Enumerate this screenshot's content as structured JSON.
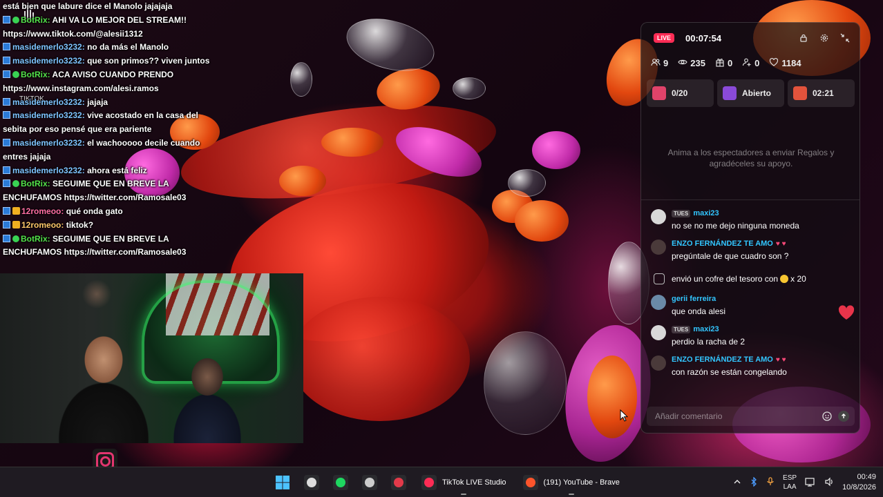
{
  "overlay_chat": [
    {
      "user": "",
      "user_style": "u-blue",
      "badges": [],
      "text": "está bien que labure dice el Manolo jajajaja"
    },
    {
      "user": "BotRix:",
      "user_style": "u-green",
      "badges": [
        "badge",
        "badge2"
      ],
      "text": " AHI VA LO MEJOR DEL STREAM!! https://www.tiktok.com/@alesii1312"
    },
    {
      "user": "masidemerlo3232:",
      "user_style": "u-blue",
      "badges": [
        "badge"
      ],
      "text": " no da más el Manolo"
    },
    {
      "user": "masidemerlo3232:",
      "user_style": "u-blue",
      "badges": [
        "badge"
      ],
      "text": " que son primos?? viven juntos"
    },
    {
      "user": "BotRix:",
      "user_style": "u-green",
      "badges": [
        "badge",
        "badge2"
      ],
      "text": " ACA AVISO CUANDO PRENDO https://www.instagram.com/alesi.ramos"
    },
    {
      "user": "masidemerlo3232:",
      "user_style": "u-blue",
      "badges": [
        "badge"
      ],
      "text": " jajaja"
    },
    {
      "user": "masidemerlo3232:",
      "user_style": "u-blue",
      "badges": [
        "badge"
      ],
      "text": " vive acostado en la casa del sebita por eso pensé que era pariente"
    },
    {
      "user": "masidemerlo3232:",
      "user_style": "u-blue",
      "badges": [
        "badge"
      ],
      "text": " el wachooooo decile cuando entres jajaja"
    },
    {
      "user": "masidemerlo3232:",
      "user_style": "u-blue",
      "badges": [
        "badge"
      ],
      "text": " ahora está feliz"
    },
    {
      "user": "BotRix:",
      "user_style": "u-green",
      "badges": [
        "badge",
        "badge2"
      ],
      "text": " SEGUIME QUE EN BREVE LA ENCHUFAMOS https://twitter.com/Ramosale03"
    },
    {
      "user": "12romeoo:",
      "user_style": "u-pink",
      "badges": [
        "badge",
        "badge3"
      ],
      "text": " qué onda gato"
    },
    {
      "user": "12romeoo:",
      "user_style": "u-yellow",
      "badges": [
        "badge",
        "badge3"
      ],
      "text": " tiktok?"
    },
    {
      "user": "BotRix:",
      "user_style": "u-green",
      "badges": [
        "badge",
        "badge2"
      ],
      "text": " SEGUIME QUE EN BREVE LA ENCHUFAMOS https://twitter.com/Ramosale03"
    }
  ],
  "overlay_mini_label": "TIKTOK",
  "live_panel": {
    "badge": "LIVE",
    "timer": "00:07:54",
    "header_icons": [
      "lock-icon",
      "gear-icon",
      "shrink-icon"
    ],
    "stats": {
      "viewers": "9",
      "views": "235",
      "gifts": "0",
      "new_followers": "0",
      "likes": "1184"
    },
    "goals": [
      {
        "icon": "rose-icon",
        "label": "0/20",
        "color": "#e0436a"
      },
      {
        "icon": "poll-icon",
        "label": "Abierto",
        "color": "#8a4ad8"
      },
      {
        "icon": "treasure-icon",
        "label": "02:21",
        "color": "#e2533c"
      }
    ],
    "gift_hint": "Anima a los espectadores a enviar Regalos y agradéceles su apoyo.",
    "comments": [
      {
        "type": "user",
        "tier": "TUES",
        "name": "maxi23",
        "text": "no se no me dejo ninguna moneda",
        "avatar_color": "#d8d8d8",
        "emoji": ""
      },
      {
        "type": "user",
        "tier": "",
        "name": "ENZO FERNÁNDEZ TE AMO",
        "text": "pregúntale de que cuadro son ?",
        "avatar_color": "#4a3a3a",
        "emoji": "♥ ♥"
      },
      {
        "type": "system",
        "text_before": "envió un cofre del tesoro con",
        "text_after": "x 20"
      },
      {
        "type": "user",
        "tier": "",
        "name": "gerii ferreira",
        "text": "que onda alesi",
        "avatar_color": "#6a8aa8",
        "emoji": ""
      },
      {
        "type": "user",
        "tier": "TUES",
        "name": "maxi23",
        "text": "perdio la racha de 2",
        "avatar_color": "#d8d8d8",
        "emoji": ""
      },
      {
        "type": "user",
        "tier": "",
        "name": "ENZO FERNÁNDEZ TE AMO",
        "text": "con razón se están congelando",
        "avatar_color": "#4a3a3a",
        "emoji": "♥ ♥"
      }
    ],
    "comment_placeholder": "Añadir comentario"
  },
  "taskbar": {
    "apps": [
      {
        "name": "start-button",
        "icon": "windows-icon",
        "label": "",
        "color": "#4cc2ff"
      },
      {
        "name": "clock-app",
        "icon": "clock-icon",
        "label": "",
        "color": "#dddddd"
      },
      {
        "name": "spotify-app",
        "icon": "spotify-icon",
        "label": "",
        "color": "#1ed760"
      },
      {
        "name": "obs-app",
        "icon": "obs-icon",
        "label": "",
        "color": "#cccccc"
      },
      {
        "name": "streamer-app",
        "icon": "streamer-icon",
        "label": "",
        "color": "#e23a4a"
      },
      {
        "name": "tiktok-live-studio-app",
        "icon": "tiktok-icon",
        "label": "TikTok LIVE Studio",
        "color": "#fe2c55"
      },
      {
        "name": "brave-browser-app",
        "icon": "brave-icon",
        "label": "(191) YouTube - Brave",
        "color": "#fb542b"
      }
    ],
    "tray": {
      "lang_top": "ESP",
      "lang_bottom": "LAA",
      "time": "00:49",
      "date": "10/8/2026"
    }
  }
}
